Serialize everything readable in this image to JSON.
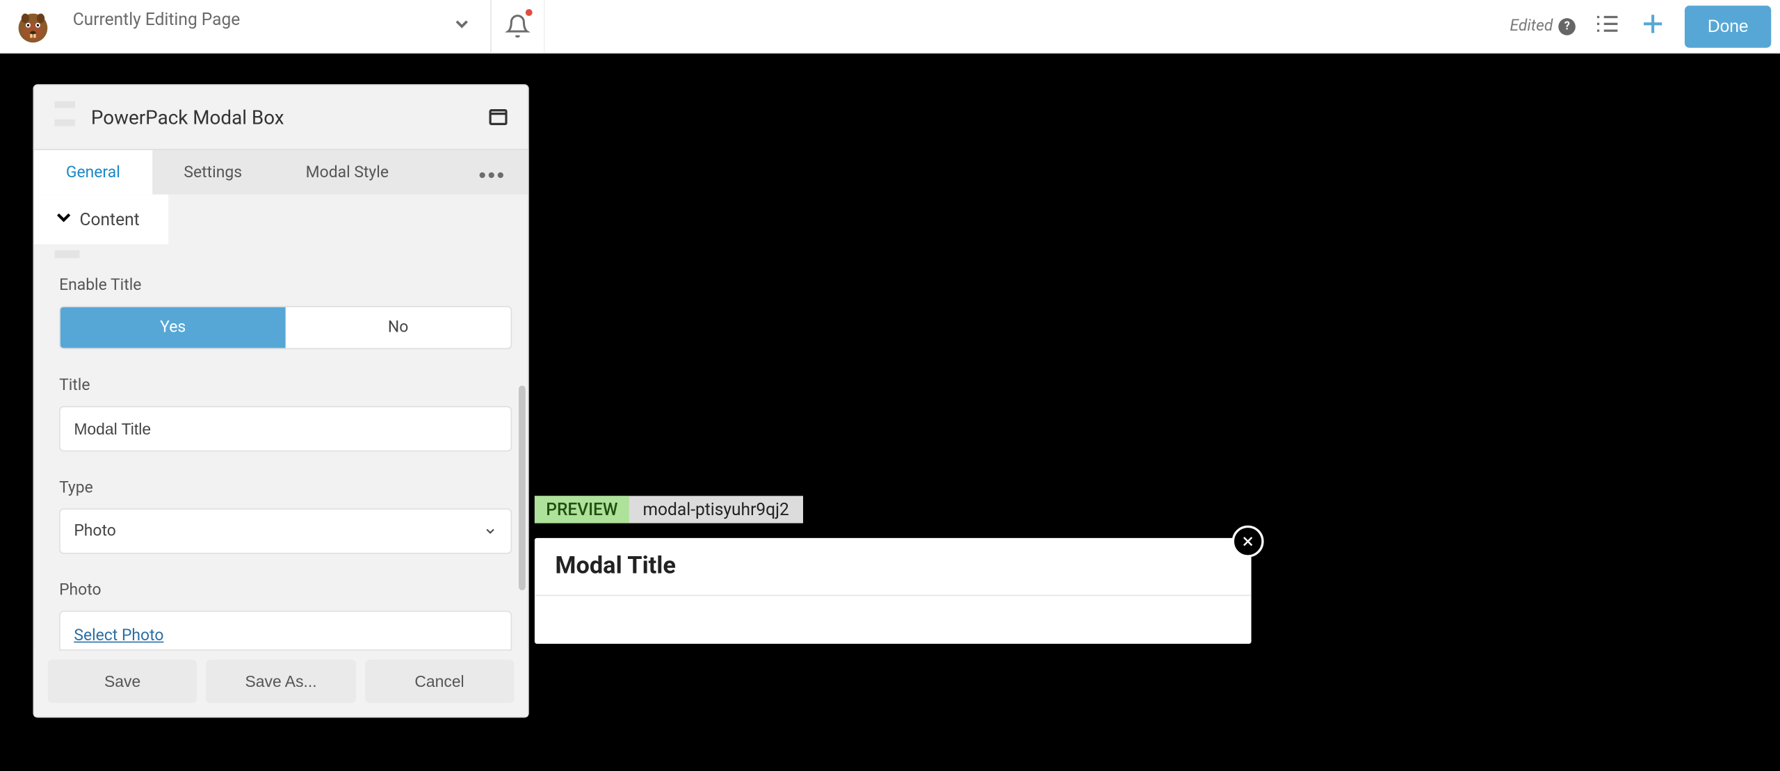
{
  "top_bar": {
    "page_name": "Currently Editing Page",
    "edited_label": "Edited",
    "done_button": "Done"
  },
  "panel": {
    "title": "PowerPack Modal Box",
    "tabs": [
      "General",
      "Settings",
      "Modal Style"
    ],
    "active_tab": "General",
    "section": "Content",
    "fields": {
      "enable_title": {
        "label": "Enable Title",
        "option_yes": "Yes",
        "option_no": "No",
        "value": "Yes"
      },
      "title": {
        "label": "Title",
        "value": "Modal Title"
      },
      "type": {
        "label": "Type",
        "value": "Photo"
      },
      "photo": {
        "label": "Photo",
        "select_link": "Select Photo"
      }
    },
    "buttons": {
      "save": "Save",
      "save_as": "Save As...",
      "cancel": "Cancel"
    }
  },
  "preview": {
    "badge": "PREVIEW",
    "id": "modal-ptisyuhr9qj2",
    "modal_title": "Modal Title"
  }
}
